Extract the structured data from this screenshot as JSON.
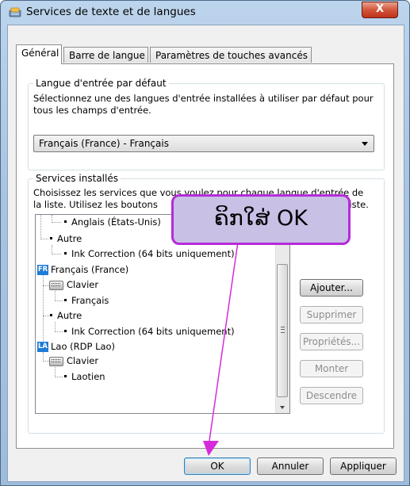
{
  "window": {
    "title": "Services de texte et de langues",
    "close_glyph": "X"
  },
  "tabs": [
    {
      "label": "Général",
      "active": true
    },
    {
      "label": "Barre de langue",
      "active": false
    },
    {
      "label": "Paramètres de touches avancés",
      "active": false
    }
  ],
  "default_language": {
    "legend": "Langue d'entrée par défaut",
    "description_line1": "Sélectionnez une des langues d'entrée installées à utiliser par défaut pour",
    "description_line2": "tous les champs d'entrée.",
    "selected_value": "Français (France) - Français"
  },
  "installed_services": {
    "legend": "Services installés",
    "description_line1": "Choisissez les services que vous voulez pour chaque langue d'entrée de",
    "description_line2_start": "la liste. Utilisez les boutons",
    "description_line2_end": "te liste.",
    "tree": {
      "rows": [
        {
          "text": "Anglais (États-Unis)",
          "kind": "item"
        },
        {
          "text": "Autre",
          "kind": "item"
        },
        {
          "text": "Ink Correction (64 bits uniquement)",
          "kind": "item"
        },
        {
          "text": "Français (France)",
          "kind": "language",
          "badge": "FR"
        },
        {
          "text": "Clavier",
          "kind": "category"
        },
        {
          "text": "Français",
          "kind": "item"
        },
        {
          "text": "Autre",
          "kind": "item"
        },
        {
          "text": "Ink Correction (64 bits uniquement)",
          "kind": "item"
        },
        {
          "text": "Lao (RDP Lao)",
          "kind": "language",
          "badge": "LA"
        },
        {
          "text": "Clavier",
          "kind": "category"
        },
        {
          "text": "Laotien",
          "kind": "item"
        }
      ]
    },
    "buttons": {
      "add": "Ajouter...",
      "remove": "Supprimer",
      "properties": "Propriétés...",
      "move_up": "Monter",
      "move_down": "Descendre"
    }
  },
  "footer": {
    "ok": "OK",
    "cancel": "Annuler",
    "apply": "Appliquer"
  },
  "annotation": {
    "callout_text": "ຄິກໃສ່ OK",
    "color": "#b72bd8",
    "fill": "#c9c0e6"
  },
  "colors": {
    "badge_blue": "#1f7bd6",
    "close_red": "#c0321c"
  },
  "icons": [
    "settings-icon",
    "close-icon",
    "keyboard-icon",
    "chevron-down-icon"
  ]
}
